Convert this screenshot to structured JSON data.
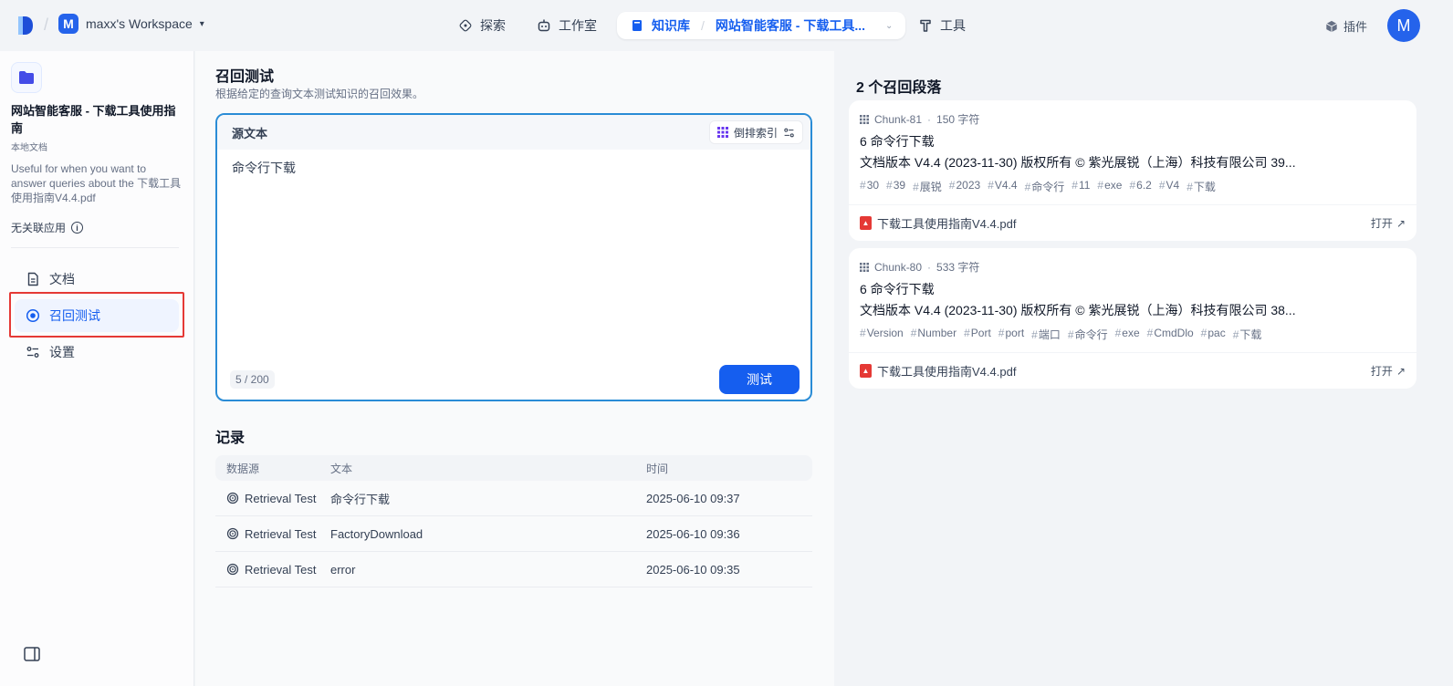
{
  "topbar": {
    "workspace_initial": "M",
    "workspace_name": "maxx's Workspace",
    "nav_explore": "探索",
    "nav_studio": "工作室",
    "nav_knowledge": "知识库",
    "nav_knowledge_current": "网站智能客服 - 下载工具...",
    "nav_tools": "工具",
    "plugins": "插件",
    "user_initial": "M"
  },
  "sidebar": {
    "kb_title": "网站智能客服 - 下载工具使用指南",
    "kb_type": "本地文档",
    "kb_description": "Useful for when you want to answer queries about the 下载工具使用指南V4.4.pdf",
    "kb_apps": "无关联应用",
    "items": [
      {
        "label": "文档",
        "icon": "document-icon"
      },
      {
        "label": "召回测试",
        "icon": "target-icon",
        "active": true
      },
      {
        "label": "设置",
        "icon": "settings-icon"
      }
    ]
  },
  "main": {
    "title": "召回测试",
    "subtitle": "根据给定的查询文本测试知识的召回效果。",
    "source_label": "源文本",
    "index_button": "倒排索引",
    "query": "命令行下载",
    "counter": "5 / 200",
    "test_button": "测试",
    "records_title": "记录",
    "records_headers": [
      "数据源",
      "文本",
      "时间"
    ],
    "records": [
      {
        "source": "Retrieval Test",
        "text": "命令行下载",
        "time": "2025-06-10 09:37"
      },
      {
        "source": "Retrieval Test",
        "text": "FactoryDownload",
        "time": "2025-06-10 09:36"
      },
      {
        "source": "Retrieval Test",
        "text": "error",
        "time": "2025-06-10 09:35"
      }
    ]
  },
  "results": {
    "title": "2 个召回段落",
    "open_label": "打开",
    "chunks": [
      {
        "id": "Chunk-81",
        "chars": "150 字符",
        "heading": "6 命令行下载",
        "body": "文档版本 V4.4 (2023-11-30) 版权所有 © 紫光展锐（上海）科技有限公司 39...",
        "tags": [
          "30",
          "39",
          "展锐",
          "2023",
          "V4.4",
          "命令行",
          "11",
          "exe",
          "6.2",
          "V4",
          "下载"
        ],
        "file": "下载工具使用指南V4.4.pdf"
      },
      {
        "id": "Chunk-80",
        "chars": "533 字符",
        "heading": "6 命令行下载",
        "body": "文档版本 V4.4 (2023-11-30) 版权所有 © 紫光展锐（上海）科技有限公司 38...",
        "tags": [
          "Version",
          "Number",
          "Port",
          "port",
          "端口",
          "命令行",
          "exe",
          "CmdDlo",
          "pac",
          "下载"
        ],
        "file": "下载工具使用指南V4.4.pdf"
      }
    ]
  },
  "colors": {
    "accent": "#155eef",
    "highlight": "#e53935"
  }
}
